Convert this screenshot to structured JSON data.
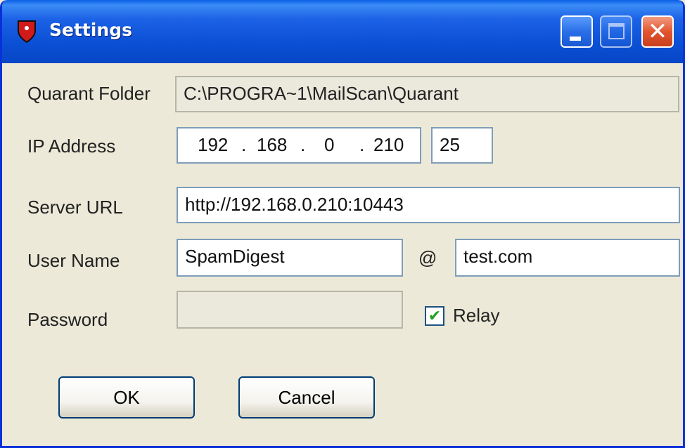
{
  "window": {
    "title": "Settings",
    "title_icon": "shield-icon"
  },
  "title_buttons": {
    "minimize": "minimize-icon",
    "maximize": "maximize-icon",
    "close": "close-icon",
    "close_glyph": "✕"
  },
  "form": {
    "quarant_folder": {
      "label": "Quarant Folder",
      "value": "C:\\PROGRA~1\\MailScan\\Quarant"
    },
    "ip_address": {
      "label": "IP Address",
      "octets": [
        "192",
        "168",
        "0",
        "210"
      ],
      "separator": ".",
      "port": "25"
    },
    "server_url": {
      "label": "Server URL",
      "value": "http://192.168.0.210:10443"
    },
    "user_name": {
      "label": "User Name",
      "value": "SpamDigest",
      "at": "@",
      "domain": "test.com"
    },
    "password": {
      "label": "Password",
      "value": ""
    },
    "relay": {
      "label": "Relay",
      "checked": true,
      "check_glyph": "✔"
    }
  },
  "buttons": {
    "ok": "OK",
    "cancel": "Cancel"
  },
  "colors": {
    "titlebar": "#0a4fd4",
    "face": "#ece9d8",
    "close": "#e2552f",
    "check": "#21a121"
  }
}
